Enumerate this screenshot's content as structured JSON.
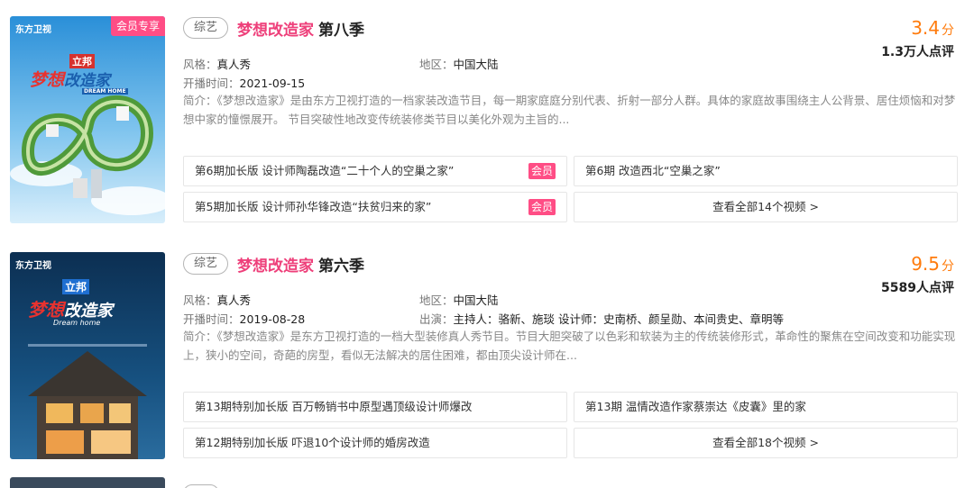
{
  "cards": [
    {
      "genre": "综艺",
      "show_name": "梦想改造家",
      "season": "第八季",
      "score": "3.4",
      "score_unit": "分",
      "votes": "1.3万人点评",
      "style_label": "风格：",
      "style_value": "真人秀",
      "region_label": "地区：",
      "region_value": "中国大陆",
      "date_label": "开播时间：",
      "date_value": "2021-09-15",
      "summary": "简介：《梦想改造家》是由东方卫视打造的一档家装改造节目，每一期家庭庭分别代表、折射一部分人群。具体的家庭故事围绕主人公背景、居住烦恼和对梦想中家的憧憬展开。 节目突破性地改变传统装修类节目以美化外观为主旨的...",
      "poster": {
        "channel": "东方卫视",
        "badge": "会员专享",
        "sponsor": "立邦",
        "logo_a": "梦想",
        "logo_b": "改造家",
        "logo_sub": "DREAM HOME"
      },
      "episodes": [
        {
          "title": "第6期加长版 设计师陶磊改造“二十个人的空巢之家”",
          "vip": "会员"
        },
        {
          "title": "第6期 改造西北“空巢之家”",
          "vip": ""
        },
        {
          "title": "第5期加长版 设计师孙华锋改造“扶贫归来的家”",
          "vip": "会员"
        }
      ],
      "view_all": "查看全部14个视频 >"
    },
    {
      "genre": "综艺",
      "show_name": "梦想改造家",
      "season": "第六季",
      "score": "9.5",
      "score_unit": "分",
      "votes": "5589人点评",
      "style_label": "风格：",
      "style_value": "真人秀",
      "region_label": "地区：",
      "region_value": "中国大陆",
      "date_label": "开播时间：",
      "date_value": "2019-08-28",
      "cast_label": "出演：",
      "cast_value": "主持人：骆新、施琰 设计师：史南桥、颜呈勋、本间贵史、章明等",
      "summary": "简介：《梦想改造家》是东方卫视打造的一档大型装修真人秀节目。节目大胆突破了以色彩和软装为主的传统装修形式，革命性的聚焦在空间改变和功能实现上，狭小的空间，奇葩的房型，看似无法解决的居住困难，都由顶尖设计师在...",
      "poster": {
        "channel": "东方卫视",
        "badge": "",
        "sponsor": "立邦",
        "logo_a": "梦想",
        "logo_b": "改造家",
        "logo_sub": "Dream home"
      },
      "episodes": [
        {
          "title": "第13期特别加长版 百万畅销书中原型遇顶级设计师爆改",
          "vip": ""
        },
        {
          "title": "第13期 温情改造作家蔡崇达《皮囊》里的家",
          "vip": ""
        },
        {
          "title": "第12期特别加长版 吓退10个设计师的婚房改造",
          "vip": ""
        }
      ],
      "view_all": "查看全部18个视频 >"
    }
  ],
  "colors": {
    "accent_pink": "#ee3f7a",
    "score_orange": "#ff7b0c",
    "vip_badge": "#ff4d85"
  }
}
